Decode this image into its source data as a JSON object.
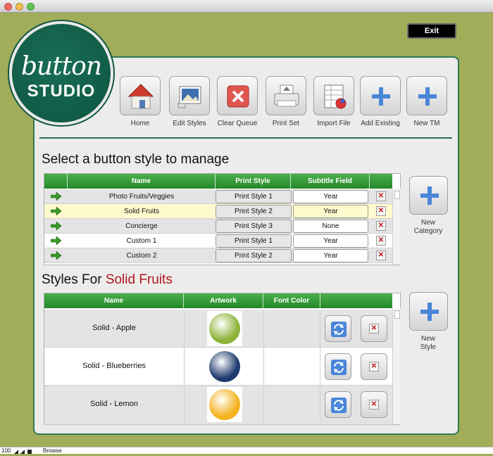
{
  "window": {
    "title": ""
  },
  "exit_label": "Exit",
  "logo": {
    "line1": "button",
    "line2": "STUDIO"
  },
  "toolbar": [
    {
      "label": "Home",
      "icon": "home-icon"
    },
    {
      "label": "Edit Styles",
      "icon": "edit-image-icon"
    },
    {
      "label": "Clear Queue",
      "icon": "clear-x-icon"
    },
    {
      "label": "Print Set",
      "icon": "printer-icon"
    },
    {
      "label": "Import File",
      "icon": "spreadsheet-icon"
    },
    {
      "label": "Add Existing",
      "icon": "plus-icon"
    },
    {
      "label": "New TM",
      "icon": "plus-icon"
    }
  ],
  "section1": {
    "title": "Select a button style to manage",
    "columns": [
      "",
      "Name",
      "Print Style",
      "Subtitle Field",
      ""
    ],
    "rows": [
      {
        "name": "Photo Fruits/Veggies",
        "print_style": "Print Style 1",
        "subtitle": "Year",
        "selected": false
      },
      {
        "name": "Solid Fruits",
        "print_style": "Print Style 2",
        "subtitle": "Year",
        "selected": true
      },
      {
        "name": "Concierge",
        "print_style": "Print Style 3",
        "subtitle": "None",
        "selected": false
      },
      {
        "name": "Custom 1",
        "print_style": "Print Style 1",
        "subtitle": "Year",
        "selected": false
      },
      {
        "name": "Custom 2",
        "print_style": "Print Style 2",
        "subtitle": "Year",
        "selected": false
      }
    ],
    "delete_glyph": "✕",
    "side_button": {
      "label_line1": "New",
      "label_line2": "Category"
    }
  },
  "section2": {
    "title_prefix": "Styles For ",
    "title_accent": "Solid Fruits",
    "columns": [
      "Name",
      "Artwork",
      "Font Color",
      ""
    ],
    "rows": [
      {
        "name": "Solid - Apple",
        "art_color": "#8db33a"
      },
      {
        "name": "Solid - Blueberries",
        "art_color": "#1f3a6e"
      },
      {
        "name": "Solid - Lemon",
        "art_color": "#f3b21f"
      }
    ],
    "delete_glyph": "✕",
    "side_button": {
      "label_line1": "New",
      "label_line2": "Style"
    }
  },
  "status_bar": {
    "zoom": "100",
    "mode": "Browse"
  },
  "colors": {
    "background": "#a2ad5a",
    "accent_green": "#2e7a51",
    "header_green": "#23872a",
    "highlight": "#fffacd",
    "accent_red": "#b0171b"
  }
}
